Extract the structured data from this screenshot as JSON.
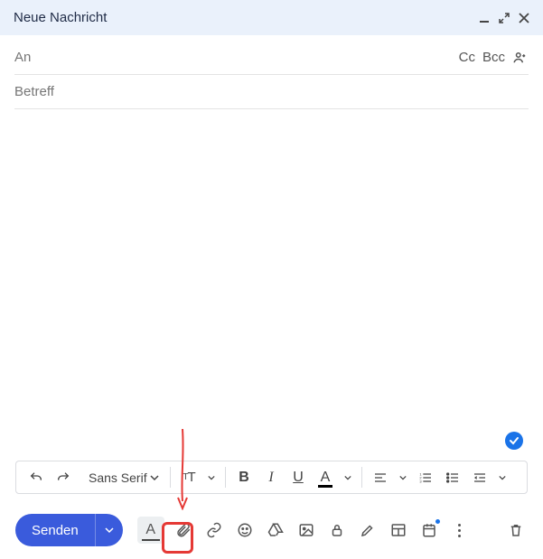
{
  "window": {
    "title": "Neue Nachricht"
  },
  "fields": {
    "to_label": "An",
    "cc_label": "Cc",
    "bcc_label": "Bcc",
    "subject_placeholder": "Betreff"
  },
  "format_toolbar": {
    "font_family": "Sans Serif",
    "font_size_label": "тT",
    "bold": "B",
    "italic": "I",
    "underline": "U",
    "text_color": "A"
  },
  "actions": {
    "send_label": "Senden"
  }
}
